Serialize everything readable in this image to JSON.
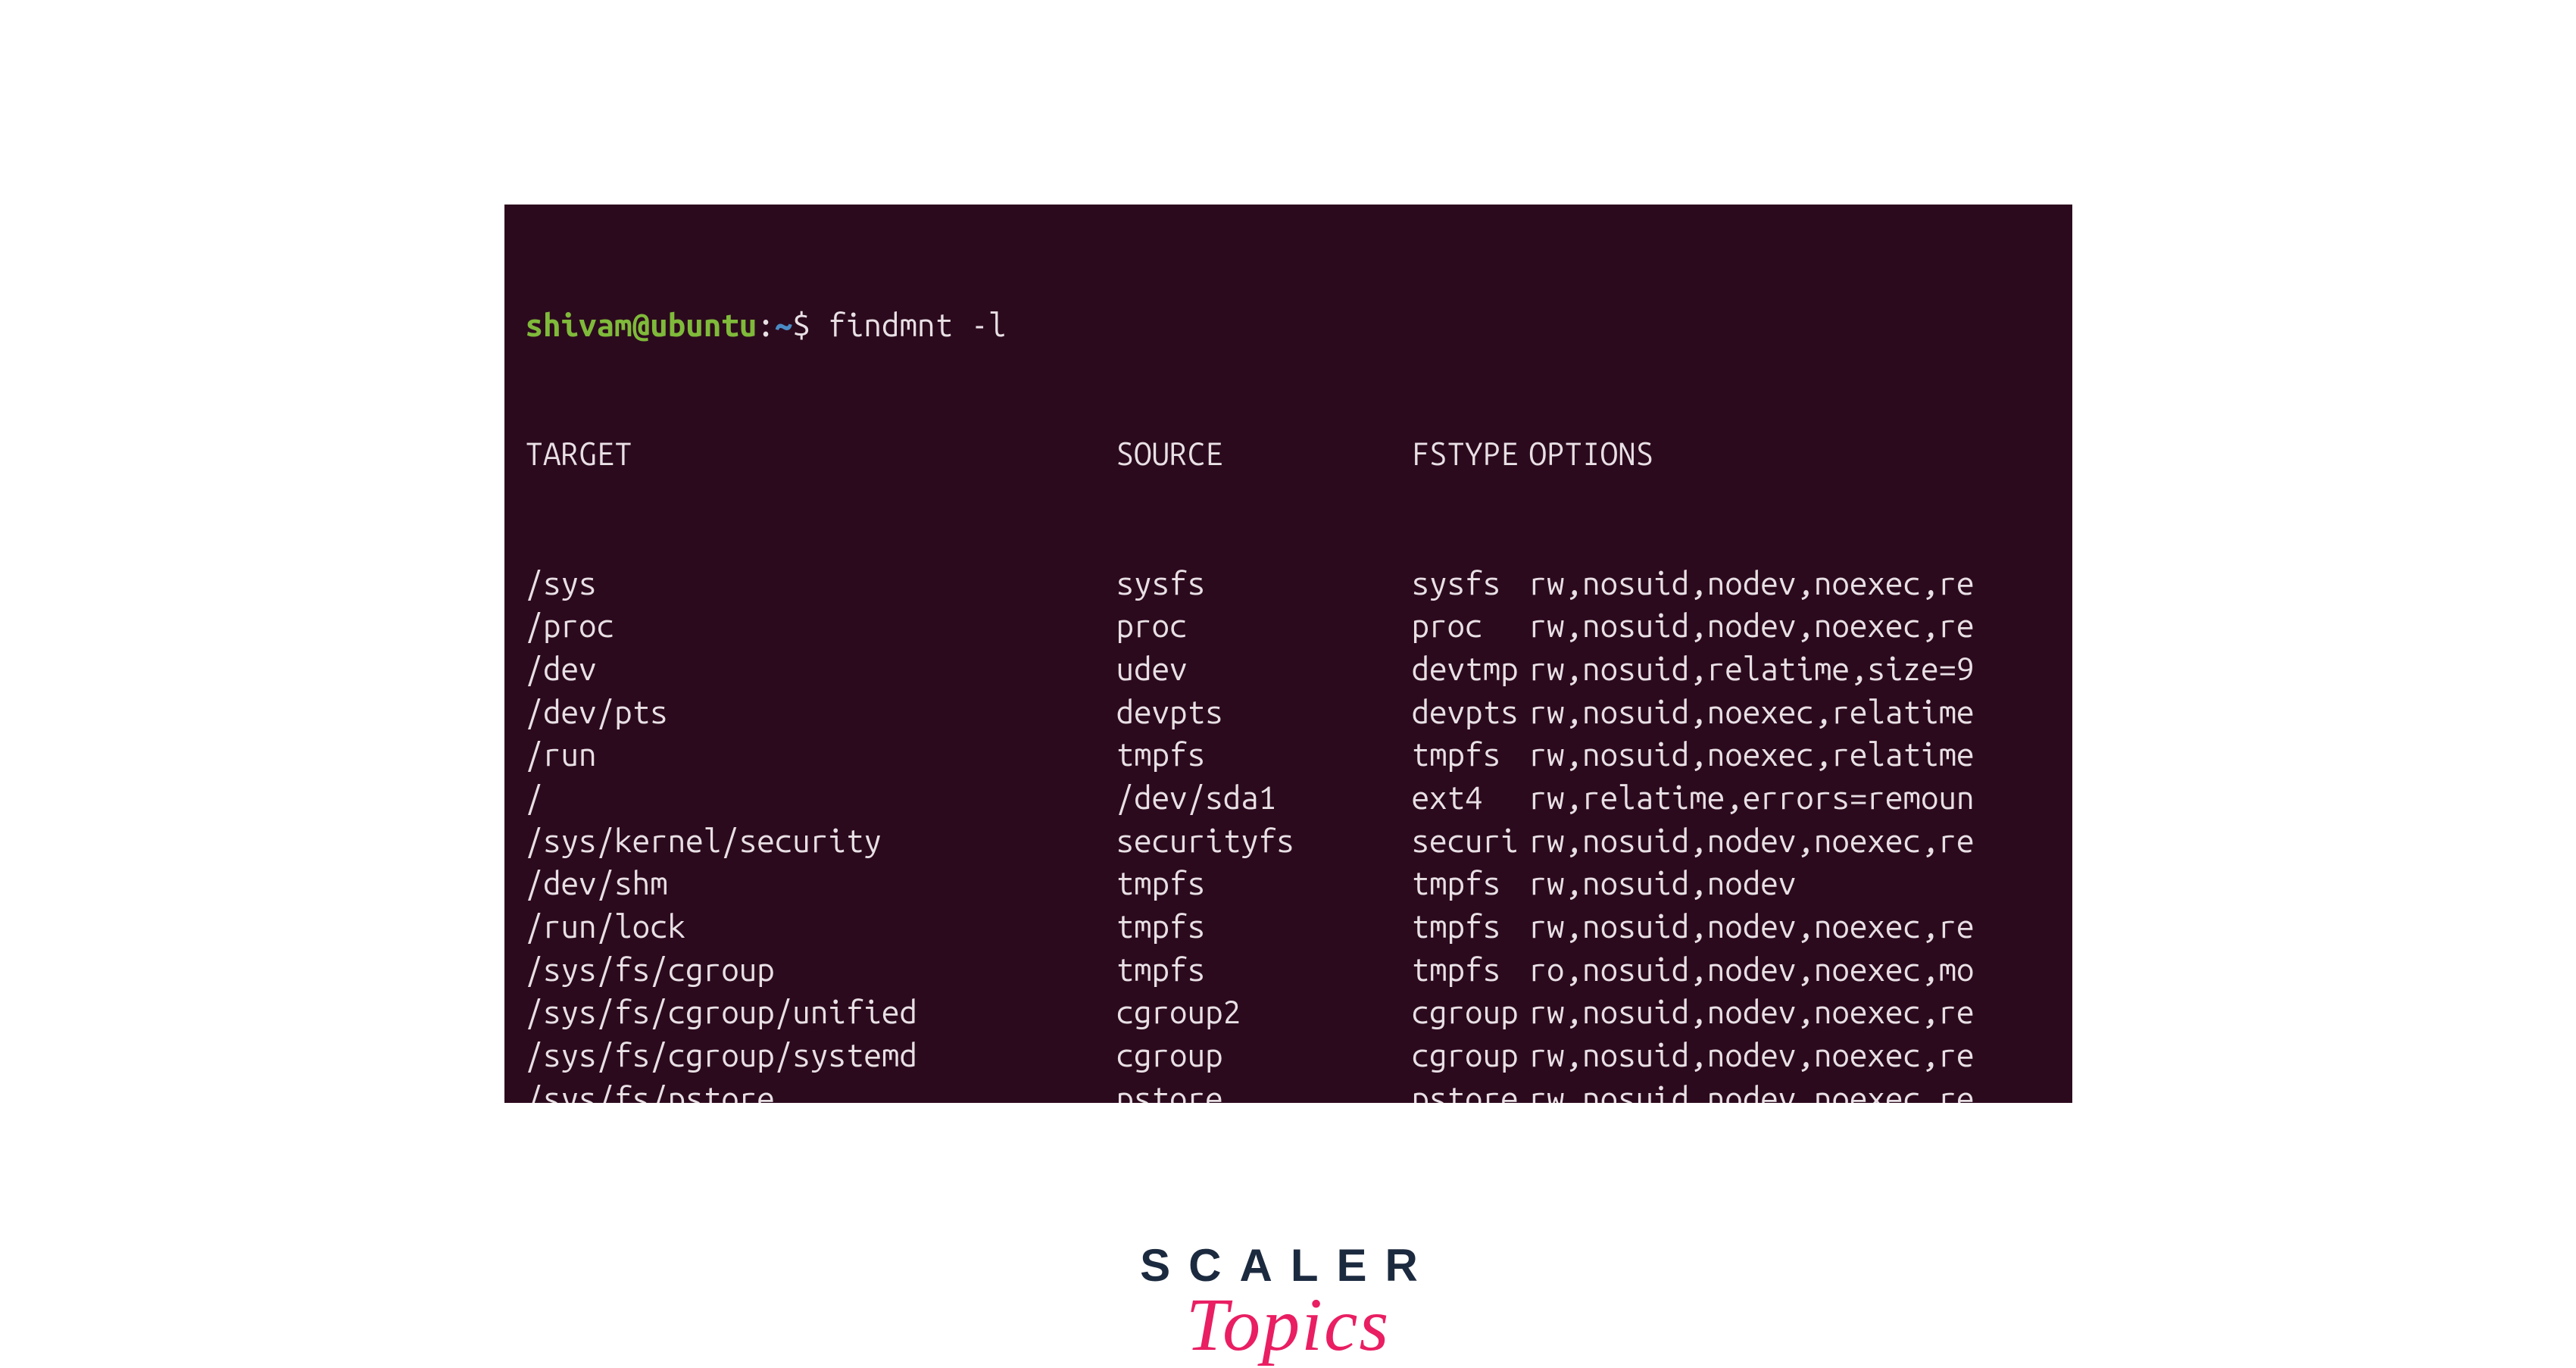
{
  "prompt": {
    "user": "shivam@ubuntu",
    "sep1": ":",
    "path": "~",
    "sep2": "$ ",
    "command": "findmnt -l"
  },
  "header": {
    "target": "TARGET",
    "source": "SOURCE",
    "fstype": "FSTYPE",
    "options": "OPTIONS"
  },
  "rows": [
    {
      "target": "/sys",
      "source": "sysfs",
      "fstype": "sysfs",
      "options": "rw,nosuid,nodev,noexec,re"
    },
    {
      "target": "/proc",
      "source": "proc",
      "fstype": "proc",
      "options": "rw,nosuid,nodev,noexec,re"
    },
    {
      "target": "/dev",
      "source": "udev",
      "fstype": "devtmp",
      "options": "rw,nosuid,relatime,size=9"
    },
    {
      "target": "/dev/pts",
      "source": "devpts",
      "fstype": "devpts",
      "options": "rw,nosuid,noexec,relatime"
    },
    {
      "target": "/run",
      "source": "tmpfs",
      "fstype": "tmpfs",
      "options": "rw,nosuid,noexec,relatime"
    },
    {
      "target": "/",
      "source": "/dev/sda1",
      "fstype": "ext4",
      "options": "rw,relatime,errors=remoun"
    },
    {
      "target": "/sys/kernel/security",
      "source": "securityfs",
      "fstype": "securi",
      "options": "rw,nosuid,nodev,noexec,re"
    },
    {
      "target": "/dev/shm",
      "source": "tmpfs",
      "fstype": "tmpfs",
      "options": "rw,nosuid,nodev"
    },
    {
      "target": "/run/lock",
      "source": "tmpfs",
      "fstype": "tmpfs",
      "options": "rw,nosuid,nodev,noexec,re"
    },
    {
      "target": "/sys/fs/cgroup",
      "source": "tmpfs",
      "fstype": "tmpfs",
      "options": "ro,nosuid,nodev,noexec,mo"
    },
    {
      "target": "/sys/fs/cgroup/unified",
      "source": "cgroup2",
      "fstype": "cgroup",
      "options": "rw,nosuid,nodev,noexec,re"
    },
    {
      "target": "/sys/fs/cgroup/systemd",
      "source": "cgroup",
      "fstype": "cgroup",
      "options": "rw,nosuid,nodev,noexec,re"
    },
    {
      "target": "/sys/fs/pstore",
      "source": "pstore",
      "fstype": "pstore",
      "options": "rw,nosuid,nodev,noexec,re"
    }
  ],
  "logo": {
    "main": "SCALER",
    "sub": "Topics"
  }
}
